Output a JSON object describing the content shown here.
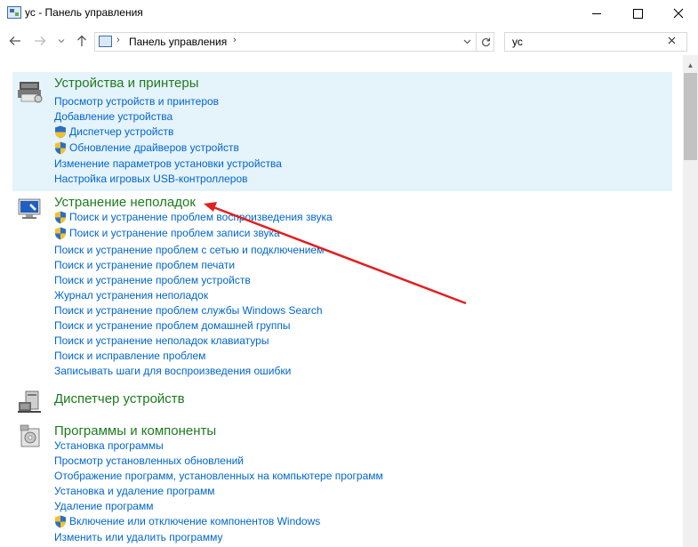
{
  "window": {
    "title": "ус - Панель управления",
    "buttons": {
      "minimize": "minimize",
      "maximize": "maximize",
      "close": "close"
    }
  },
  "navigation": {
    "address_text": "Панель управления",
    "search_value": "ус"
  },
  "groups": [
    {
      "heading": "Устройства и принтеры",
      "icon": "printer-devices-icon",
      "highlighted": true,
      "tasks": [
        {
          "label": "Просмотр устройств и принтеров",
          "shield": false
        },
        {
          "label": "Добавление устройства",
          "shield": false
        },
        {
          "label": "Диспетчер устройств",
          "shield": true
        },
        {
          "label": "Обновление драйверов устройств",
          "shield": true
        },
        {
          "label": "Изменение параметров установки устройства",
          "shield": false
        },
        {
          "label": "Настройка игровых USB-контроллеров",
          "shield": false
        }
      ]
    },
    {
      "heading": "Устранение неполадок",
      "icon": "troubleshooting-icon",
      "highlighted": false,
      "tasks": [
        {
          "label": "Поиск и устранение проблем воспроизведения звука",
          "shield": true
        },
        {
          "label": "Поиск и устранение проблем записи звука",
          "shield": true
        },
        {
          "label": "Поиск и устранение проблем с сетью и подключением",
          "shield": false
        },
        {
          "label": "Поиск и устранение проблем печати",
          "shield": false
        },
        {
          "label": "Поиск и устранение проблем устройств",
          "shield": false
        },
        {
          "label": "Журнал устранения неполадок",
          "shield": false
        },
        {
          "label": "Поиск и устранение проблем службы Windows Search",
          "shield": false
        },
        {
          "label": "Поиск и устранение проблем домашней группы",
          "shield": false
        },
        {
          "label": "Поиск и устранение неполадок клавиатуры",
          "shield": false
        },
        {
          "label": "Поиск и исправление проблем",
          "shield": false
        },
        {
          "label": "Записывать шаги для воспроизведения ошибки",
          "shield": false
        }
      ]
    },
    {
      "heading": "Диспетчер устройств",
      "icon": "device-manager-icon",
      "highlighted": false,
      "tasks": []
    },
    {
      "heading": "Программы и компоненты",
      "icon": "programs-features-icon",
      "highlighted": false,
      "tasks": [
        {
          "label": "Установка программы",
          "shield": false
        },
        {
          "label": "Просмотр установленных обновлений",
          "shield": false
        },
        {
          "label": "Отображение программ, установленных на компьютере программ",
          "shield": false
        },
        {
          "label": "Установка и удаление программ",
          "shield": false
        },
        {
          "label": "Удаление программ",
          "shield": false
        },
        {
          "label": "Включение или отключение компонентов Windows",
          "shield": true
        },
        {
          "label": "Изменить или удалить программу",
          "shield": false
        }
      ]
    }
  ],
  "colors": {
    "heading": "#1e7b1e",
    "link": "#0066cc",
    "highlight": "#e5f3fb",
    "annotation_arrow": "#e02020"
  }
}
